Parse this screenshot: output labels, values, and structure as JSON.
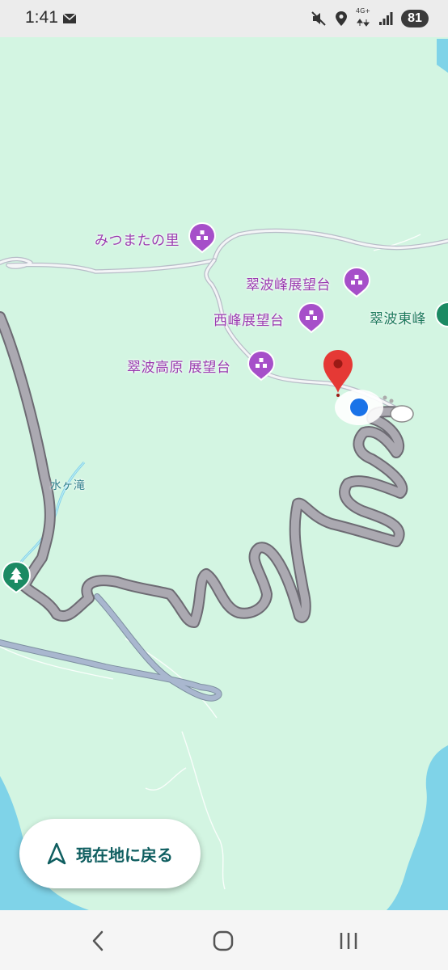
{
  "status_bar": {
    "time": "1:41",
    "network": "4G+",
    "battery": "81",
    "icons": [
      "mail-icon",
      "mute-icon",
      "location-icon",
      "data-arrows-icon",
      "signal-icon"
    ]
  },
  "map": {
    "pois": [
      {
        "label": "みつまたの里",
        "type": "viewpoint"
      },
      {
        "label": "翠波峰展望台",
        "type": "viewpoint"
      },
      {
        "label": "西峰展望台",
        "type": "viewpoint"
      },
      {
        "label": "翠波高原 展望台",
        "type": "viewpoint"
      },
      {
        "label": "翠波東峰",
        "type": "peak"
      },
      {
        "label": "水ヶ滝",
        "type": "waterfall"
      }
    ],
    "colors": {
      "land": "#d3f5e2",
      "water": "#7fd3e8",
      "route": "#a8a6ad",
      "poi_purple": "#a64fc9",
      "peak_green": "#1b8a63",
      "pin_red": "#e53935",
      "location_blue": "#1a73e8"
    }
  },
  "recenter": {
    "label": "現在地に戻る",
    "icon": "navigation-arrow-icon"
  },
  "nav_bar": {
    "buttons": [
      "back-icon",
      "home-icon",
      "recents-icon"
    ]
  }
}
